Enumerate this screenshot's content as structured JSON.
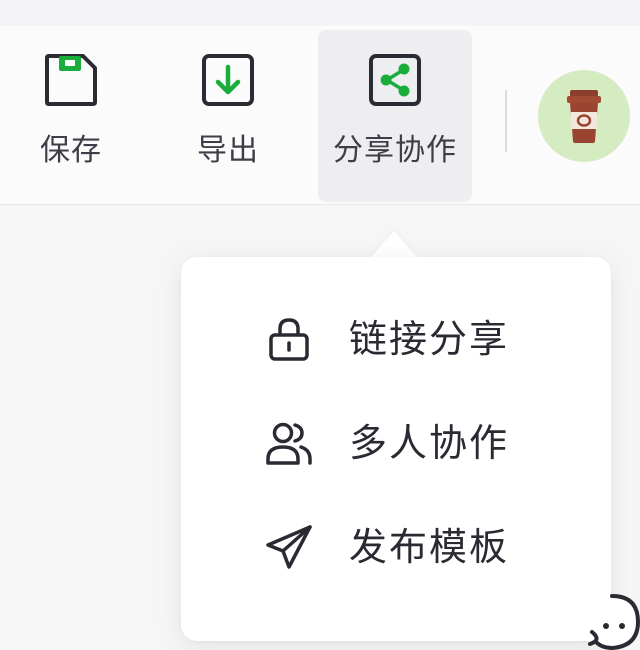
{
  "toolbar": {
    "save_label": "保存",
    "export_label": "导出",
    "share_label": "分享协作"
  },
  "share_menu": {
    "items": [
      {
        "label": "链接分享",
        "icon": "lock-icon"
      },
      {
        "label": "多人协作",
        "icon": "users-icon"
      },
      {
        "label": "发布模板",
        "icon": "paper-plane-icon"
      }
    ]
  },
  "colors": {
    "accent_green": "#1aad3c",
    "icon_stroke": "#2b2b33",
    "avatar_bg": "#d5ecc2"
  },
  "avatar": {
    "icon": "coffee-cup-icon"
  }
}
